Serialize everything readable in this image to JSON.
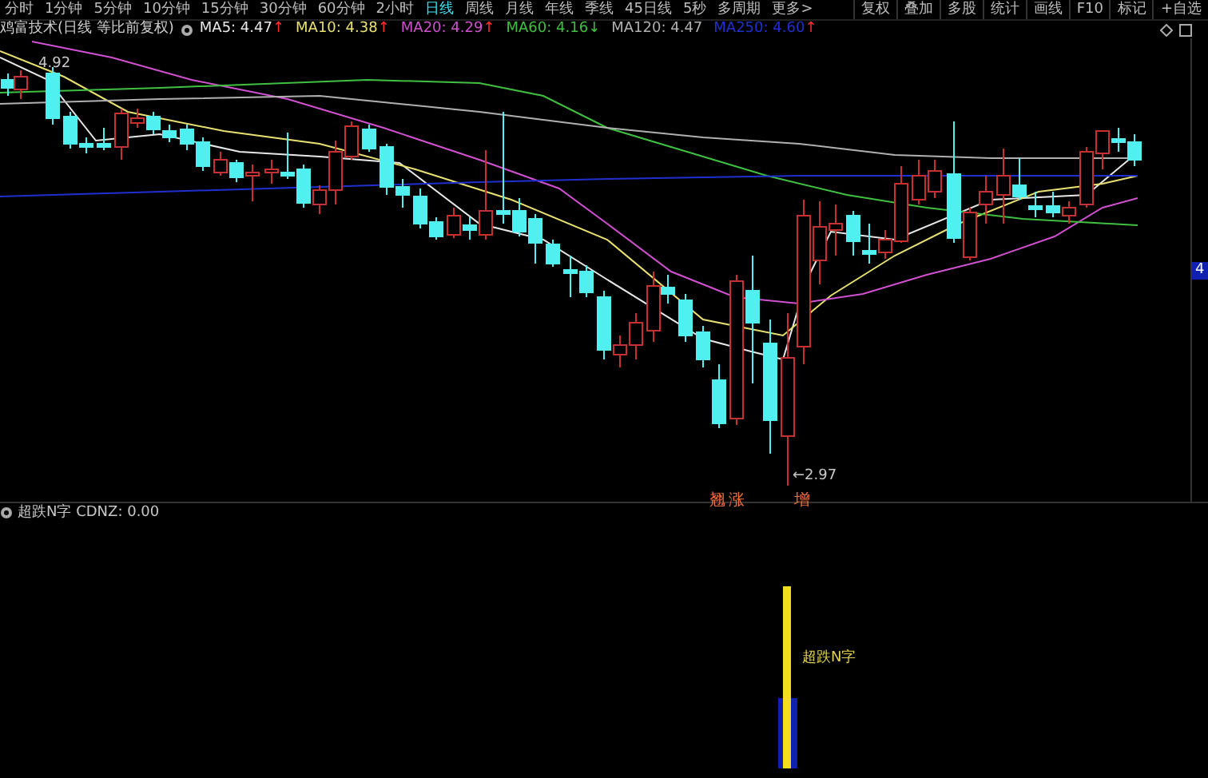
{
  "toolbar": {
    "periods": [
      {
        "label": "分时",
        "selected": false
      },
      {
        "label": "1分钟",
        "selected": false
      },
      {
        "label": "5分钟",
        "selected": false
      },
      {
        "label": "10分钟",
        "selected": false
      },
      {
        "label": "15分钟",
        "selected": false
      },
      {
        "label": "30分钟",
        "selected": false
      },
      {
        "label": "60分钟",
        "selected": false
      },
      {
        "label": "2小时",
        "selected": false
      },
      {
        "label": "日线",
        "selected": true
      },
      {
        "label": "周线",
        "selected": false
      },
      {
        "label": "月线",
        "selected": false
      },
      {
        "label": "年线",
        "selected": false
      },
      {
        "label": "季线",
        "selected": false
      },
      {
        "label": "45日线",
        "selected": false
      },
      {
        "label": "5秒",
        "selected": false
      },
      {
        "label": "多周期",
        "selected": false
      },
      {
        "label": "更多>",
        "selected": false
      }
    ],
    "buttons": [
      "复权",
      "叠加",
      "多股",
      "统计",
      "画线",
      "F10",
      "标记",
      "+自选"
    ]
  },
  "legend": {
    "title": "鸡富技术(日线 等比前复权)",
    "averages": [
      {
        "label": "MA5: 4.47",
        "arrow": "↑",
        "rising": true,
        "color": "#e8e8e8"
      },
      {
        "label": "MA10: 4.38",
        "arrow": "↑",
        "rising": true,
        "color": "#e8e070"
      },
      {
        "label": "MA20: 4.29",
        "arrow": "↑",
        "rising": true,
        "color": "#d050d0"
      },
      {
        "label": "MA60: 4.16",
        "arrow": "↓",
        "rising": false,
        "color": "#40c040"
      },
      {
        "label": "MA120: 4.47",
        "color": "#b0b0b0"
      },
      {
        "label": "MA250: 4.60",
        "arrow": "↑",
        "rising": true,
        "color": "#2030d0"
      }
    ]
  },
  "main_chart": {
    "high_label": "4.92",
    "low_label": "←2.97",
    "signal_labels": [
      "翘",
      "涨",
      "增"
    ],
    "axis_label": "4"
  },
  "indicator": {
    "title": "超跌N字 CDNZ: 0.00",
    "signal_label": "超跌N字"
  }
}
